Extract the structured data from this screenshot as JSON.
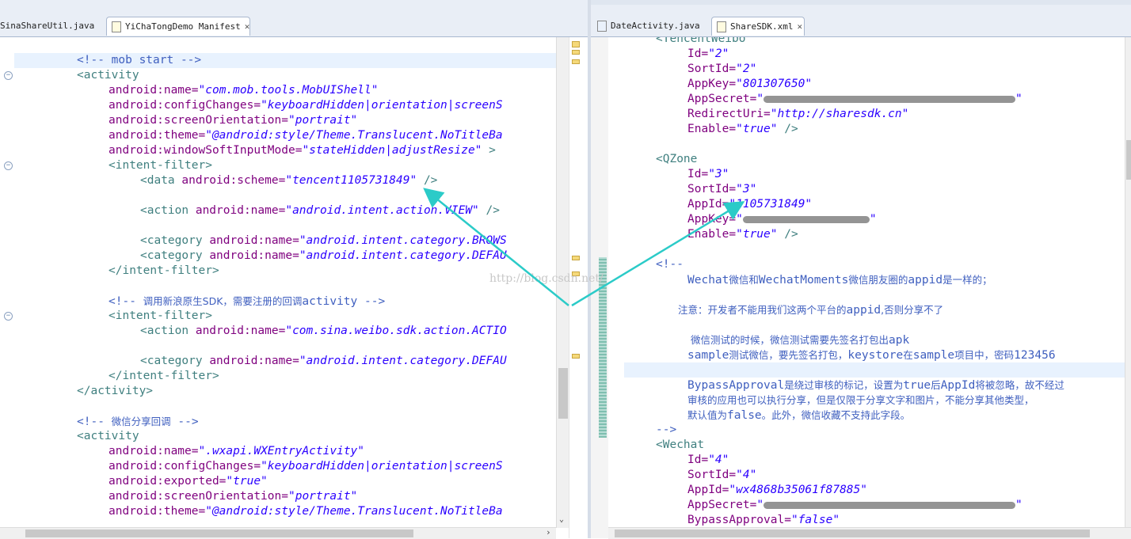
{
  "left_tabs": [
    {
      "label": "SinaShareUtil.java",
      "active": false
    },
    {
      "label": "YiChaTongDemo Manifest",
      "active": true
    }
  ],
  "right_tabs": [
    {
      "label": "DateActivity.java",
      "active": false
    },
    {
      "label": "ShareSDK.xml",
      "active": true
    }
  ],
  "left_code": {
    "l1": "<!-- mob start -->",
    "l2": "<activity",
    "l3_attr": "android:name=",
    "l3_val": "\"com.mob.tools.MobUIShell\"",
    "l4_attr": "android:configChanges=",
    "l4_val": "\"keyboardHidden|orientation|screenS",
    "l5_attr": "android:screenOrientation=",
    "l5_val": "\"portrait\"",
    "l6_attr": "android:theme=",
    "l6_val": "\"@android:style/Theme.Translucent.NoTitleBa",
    "l7_attr": "android:windowSoftInputMode=",
    "l7_val": "\"stateHidden|adjustResize\"",
    "l7_end": " >",
    "l8": "<intent-filter>",
    "l9_tag": "<data ",
    "l9_attr": "android:scheme=",
    "l9_val": "\"tencent1105731849\"",
    "l9_end": " />",
    "l10_tag": "<action ",
    "l10_attr": "android:name=",
    "l10_val": "\"android.intent.action.VIEW\"",
    "l10_end": " />",
    "l11_tag": "<category ",
    "l11_attr": "android:name=",
    "l11_val": "\"android.intent.category.BROWS",
    "l12_tag": "<category ",
    "l12_attr": "android:name=",
    "l12_val": "\"android.intent.category.DEFAU",
    "l13": "</intent-filter>",
    "l14_a": "<!-- ",
    "l14_cn": "调用新浪原生SDK，需要注册的回调",
    "l14_b": "activity -->",
    "l15": "<intent-filter>",
    "l16_tag": "<action ",
    "l16_attr": "android:name=",
    "l16_val": "\"com.sina.weibo.sdk.action.ACTIO",
    "l17_tag": "<category ",
    "l17_attr": "android:name=",
    "l17_val": "\"android.intent.category.DEFAU",
    "l18": "</intent-filter>",
    "l19": "</activity>",
    "l20_a": "<!-- ",
    "l20_cn": "微信分享回调",
    "l20_b": " -->",
    "l21": "<activity",
    "l22_attr": "android:name=",
    "l22_val": "\".wxapi.WXEntryActivity\"",
    "l23_attr": "android:configChanges=",
    "l23_val": "\"keyboardHidden|orientation|screenS",
    "l24_attr": "android:exported=",
    "l24_val": "\"true\"",
    "l25_attr": "android:screenOrientation=",
    "l25_val": "\"portrait\"",
    "l26_attr": "android:theme=",
    "l26_val": "\"@android:style/Theme.Translucent.NoTitleBa"
  },
  "right_code": {
    "r0": "<TencentWeibo",
    "r1_attr": "Id=",
    "r1_val": "\"2\"",
    "r2_attr": "SortId=",
    "r2_val": "\"2\"",
    "r3_attr": "AppKey=",
    "r3_val": "\"801307650\"",
    "r4_attr": "AppSecret=",
    "r4_q": "\"",
    "r5_attr": "RedirectUri=",
    "r5_val": "\"http://sharesdk.cn\"",
    "r6_attr": "Enable=",
    "r6_val": "\"true\"",
    "r6_end": " />",
    "r7": "<QZone",
    "r8_attr": "Id=",
    "r8_val": "\"3\"",
    "r9_attr": "SortId=",
    "r9_val": "\"3\"",
    "r10_attr": "AppId=",
    "r10_val": "\"1105731849\"",
    "r11_attr": "AppKey=",
    "r11_q": "\"",
    "r12_attr": "Enable=",
    "r12_val": "\"true\"",
    "r12_end": " />",
    "r13": "<!--",
    "r14_a": "Wechat",
    "r14_cn1": "微信和",
    "r14_b": "WechatMoments",
    "r14_cn2": "微信朋友圈的",
    "r14_c": "appid",
    "r14_cn3": "是一样的；",
    "r15_cn": "注意：开发者不能用我们这两个平台的",
    "r15_a": "appid",
    "r15_cn2": ",否则分享不了",
    "r16_cn": "微信测试的时候，微信测试需要先签名打包出",
    "r16_a": "apk",
    "r17_a": "sample",
    "r17_cn": "测试微信，要先签名打包，",
    "r17_b": "keystore",
    "r17_cn2": "在",
    "r17_c": "sample",
    "r17_cn3": "项目中，密码",
    "r17_d": "123456",
    "r18_a": "BypassApproval",
    "r18_cn": "是绕过审核的标记，设置为",
    "r18_b": "true",
    "r18_cn2": "后",
    "r18_c": "AppId",
    "r18_cn3": "将被忽略，故不经过",
    "r19_cn": "审核的应用也可以执行分享，但是仅限于分享文字和图片，不能分享其他类型，",
    "r20_cn": "默认值为",
    "r20_a": "false",
    "r20_cn2": "。此外，微信收藏不支持此字段。",
    "r21": "-->",
    "r22": "<Wechat",
    "r23_attr": "Id=",
    "r23_val": "\"4\"",
    "r24_attr": "SortId=",
    "r24_val": "\"4\"",
    "r25_attr": "AppId=",
    "r25_val": "\"wx4868b35061f87885\"",
    "r26_attr": "AppSecret=",
    "r26_q": "\"",
    "r27_attr": "BypassApproval=",
    "r27_val": "\"false\""
  },
  "watermark": "http://blog.csdn.net/",
  "colors": {
    "tag": "#3f7f7f",
    "attr": "#7f007f",
    "string": "#2a00ff",
    "comment": "#3f5fbf",
    "arrow": "#2bcbc8"
  }
}
